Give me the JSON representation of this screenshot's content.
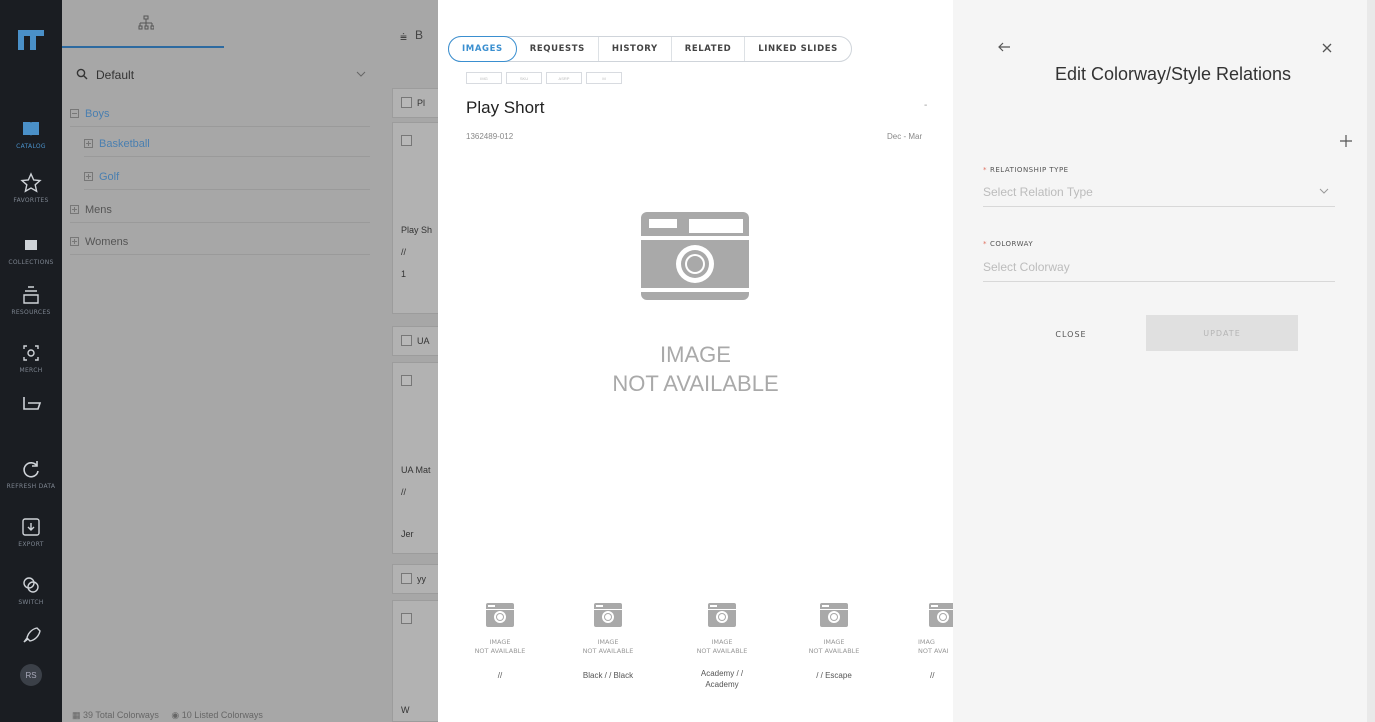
{
  "nav": {
    "items": [
      {
        "label": "CATALOG",
        "icon": "book-icon"
      },
      {
        "label": "FAVORITES",
        "icon": "star-icon"
      },
      {
        "label": "COLLECTIONS",
        "icon": "folder-icon"
      },
      {
        "label": "RESOURCES",
        "icon": "stack-icon"
      },
      {
        "label": "MERCH",
        "icon": "merch-icon"
      },
      {
        "label": "",
        "icon": "board-icon"
      },
      {
        "label": "REFRESH DATA",
        "icon": "refresh-icon"
      },
      {
        "label": "EXPORT",
        "icon": "export-icon"
      },
      {
        "label": "SWITCH",
        "icon": "switch-icon"
      },
      {
        "label": "",
        "icon": "rocket-icon"
      }
    ],
    "avatar": "RS"
  },
  "tree": {
    "search_value": "Default",
    "nodes": [
      {
        "label": "Boys"
      },
      {
        "label": "Basketball"
      },
      {
        "label": "Golf"
      },
      {
        "label": "Mens"
      },
      {
        "label": "Womens"
      }
    ],
    "footer_total": "39 Total Colorways",
    "footer_listed": "10 Listed Colorways"
  },
  "list": {
    "sort_letter": "B",
    "cards": [
      {
        "a": "Pl"
      },
      {
        "a": "Play Sh",
        "b": "//",
        "c": "1"
      },
      {
        "a": "UA"
      },
      {
        "a": "UA Mat",
        "b": "//",
        "c": "Jer"
      },
      {
        "a": "yy"
      },
      {
        "a": "W"
      }
    ]
  },
  "modal": {
    "tabs": [
      "IMAGES",
      "REQUESTS",
      "HISTORY",
      "RELATED",
      "LINKED SLIDES"
    ],
    "active_tab": "IMAGES",
    "chips": [
      "IMG",
      "SKU",
      "ASRP",
      "M"
    ],
    "title": "Play Short",
    "dot": "-",
    "sku": "1362489-012",
    "season": "Dec - Mar",
    "image_na_line1": "IMAGE",
    "image_na_line2": "NOT AVAILABLE",
    "thumbs": [
      {
        "na1": "IMAGE",
        "na2": "NOT AVAILABLE",
        "name": "//"
      },
      {
        "na1": "IMAGE",
        "na2": "NOT AVAILABLE",
        "name": "Black / / Black"
      },
      {
        "na1": "IMAGE",
        "na2": "NOT AVAILABLE",
        "name": "Academy / / Academy"
      },
      {
        "na1": "IMAGE",
        "na2": "NOT AVAILABLE",
        "name": "/ / Escape"
      },
      {
        "na1": "IMAG",
        "na2": "NOT AVAI",
        "name": "//"
      }
    ]
  },
  "side": {
    "title": "Edit Colorway/Style Relations",
    "relationship_label": "RELATIONSHIP TYPE",
    "relationship_placeholder": "Select Relation Type",
    "colorway_label": "COLORWAY",
    "colorway_placeholder": "Select Colorway",
    "close_label": "CLOSE",
    "update_label": "UPDATE"
  },
  "colors": {
    "accent": "#3a8fd0",
    "rail": "#1a1d22",
    "overlay": "#a7a7a7",
    "required": "#e07060"
  }
}
